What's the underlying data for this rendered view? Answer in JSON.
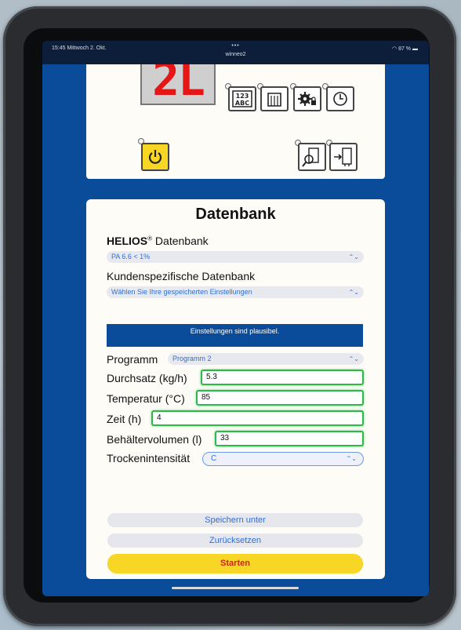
{
  "status_bar": {
    "time": "15:45  Mittwoch 2. Okt.",
    "dots": "•••",
    "url": "winneo2",
    "battery": "87 %"
  },
  "device": {
    "display_code": "2L",
    "icons": [
      "numbers-abc-icon",
      "hopper-icon",
      "gear-lock-icon",
      "clock-icon",
      "power-icon",
      "magnifier-dryer-icon",
      "dryer-connect-icon"
    ]
  },
  "form": {
    "title": "Datenbank",
    "helios_label_brand": "HELIOS",
    "helios_label_reg": "®",
    "helios_label_rest": " Datenbank",
    "helios_value": "PA 6.6 < 1%",
    "customer_label": "Kundenspezifische Datenbank",
    "customer_value": "Wählen Sie Ihre gespeicherten Einstellungen",
    "banner": "Einstellungen sind plausibel.",
    "program_label": "Programm",
    "program_value": "Programm 2",
    "throughput_label": "Durchsatz (kg/h)",
    "throughput_value": "5.3",
    "temperature_label": "Temperatur (°C)",
    "temperature_value": "85",
    "time_label": "Zeit (h)",
    "time_value": "4",
    "volume_label": "Behältervolumen (l)",
    "volume_value": "33",
    "intensity_label": "Trockenintensität",
    "intensity_value": "C",
    "save_label": "Speichern unter",
    "reset_label": "Zurücksetzen",
    "start_label": "Starten"
  },
  "colors": {
    "screen_blue": "#0a4c9a",
    "accent_yellow": "#f7d626",
    "start_red": "#d3211c",
    "valid_green": "#2fb84a",
    "link_blue": "#2f6fd6"
  }
}
